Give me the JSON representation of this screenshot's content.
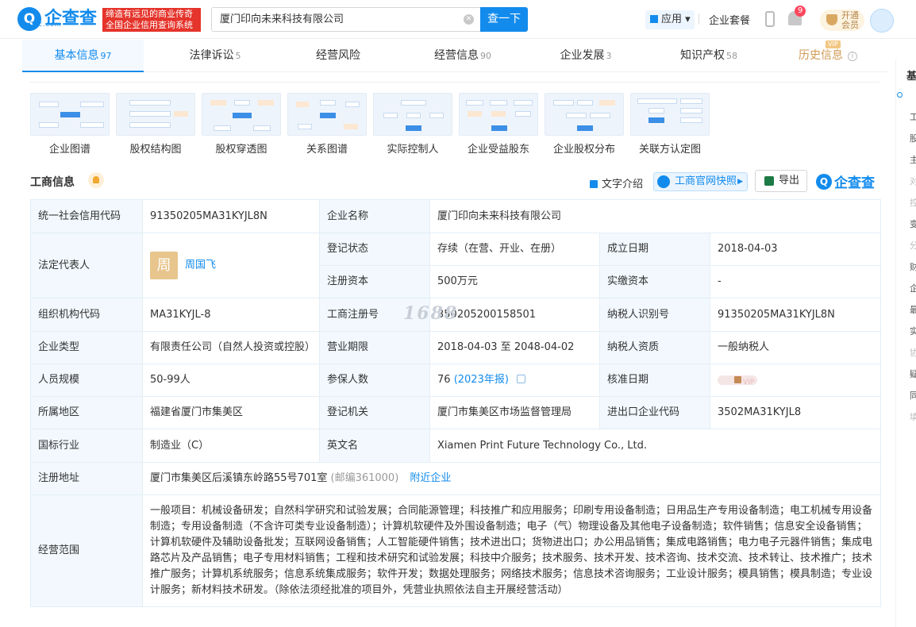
{
  "header": {
    "logo_mark": "Q",
    "logo_text": "企查查",
    "logo_sub": "Qcc.com",
    "slogan_line1": "缔造有远见的商业传奇",
    "slogan_line2": "全国企业信用查询系统",
    "search_value": "厦门印向未来科技有限公司",
    "search_button": "查一下",
    "app_label": "应用",
    "suite_label": "企业套餐",
    "notification_count": "9",
    "vip_line1": "开通",
    "vip_line2": "会员"
  },
  "tabs": [
    {
      "label": "基本信息",
      "count": "97"
    },
    {
      "label": "法律诉讼",
      "count": "5"
    },
    {
      "label": "经营风险",
      "count": ""
    },
    {
      "label": "经营信息",
      "count": "90"
    },
    {
      "label": "企业发展",
      "count": "3"
    },
    {
      "label": "知识产权",
      "count": "58"
    },
    {
      "label": "历史信息",
      "count": "",
      "badge": "VIP"
    }
  ],
  "graphs": [
    "企业图谱",
    "股权结构图",
    "股权穿透图",
    "关系图谱",
    "实际控制人",
    "企业受益股东",
    "企业股权分布",
    "关联方认定图"
  ],
  "section": {
    "title": "工商信息",
    "text_intro": "文字介绍",
    "snapshot": "工商官网快照",
    "export": "导出",
    "brand": "企查查"
  },
  "info": {
    "credit_code_label": "统一社会信用代码",
    "credit_code": "91350205MA31KYJL8N",
    "company_name_label": "企业名称",
    "company_name": "厦门印向未来科技有限公司",
    "legal_rep_label": "法定代表人",
    "legal_rep_avatar": "周",
    "legal_rep": "周国飞",
    "status_label": "登记状态",
    "status": "存续（在营、开业、在册）",
    "founded_label": "成立日期",
    "founded": "2018-04-03",
    "reg_capital_label": "注册资本",
    "reg_capital": "500万元",
    "paid_capital_label": "实缴资本",
    "paid_capital": "-",
    "org_code_label": "组织机构代码",
    "org_code": "MA31KYJL-8",
    "reg_no_label": "工商注册号",
    "reg_no": "350205200158501",
    "taxpayer_id_label": "纳税人识别号",
    "taxpayer_id": "91350205MA31KYJL8N",
    "company_type_label": "企业类型",
    "company_type": "有限责任公司（自然人投资或控股）",
    "term_label": "营业期限",
    "term": "2018-04-03 至 2048-04-02",
    "taxpayer_qual_label": "纳税人资质",
    "taxpayer_qual": "一般纳税人",
    "staff_label": "人员规模",
    "staff": "50-99人",
    "insured_label": "参保人数",
    "insured": "76",
    "insured_year": "(2023年报)",
    "approval_label": "核准日期",
    "approval_masked": "VIP",
    "region_label": "所属地区",
    "region": "福建省厦门市集美区",
    "authority_label": "登记机关",
    "authority": "厦门市集美区市场监督管理局",
    "ie_code_label": "进出口企业代码",
    "ie_code": "3502MA31KYJL8",
    "industry_label": "国标行业",
    "industry": "制造业（C）",
    "english_label": "英文名",
    "english": "Xiamen Print Future Technology Co., Ltd.",
    "address_label": "注册地址",
    "address": "厦门市集美区后溪镇东岭路55号701室",
    "postcode": "(邮编361000)",
    "nearby": "附近企业",
    "scope_label": "经营范围",
    "scope": "一般项目：机械设备研发；自然科学研究和试验发展；合同能源管理；科技推广和应用服务；印刷专用设备制造；日用品生产专用设备制造；电工机械专用设备制造；专用设备制造（不含许可类专业设备制造）；计算机软硬件及外围设备制造；电子（气）物理设备及其他电子设备制造；软件销售；信息安全设备销售；计算机软硬件及辅助设备批发；互联网设备销售；人工智能硬件销售；技术进出口；货物进出口；办公用品销售；集成电路销售；电力电子元器件销售；集成电路芯片及产品销售；电子专用材料销售；工程和技术研究和试验发展；科技中介服务；技术服务、技术开发、技术咨询、技术交流、技术转让、技术推广；技术推广服务；计算机系统服务；信息系统集成服务；软件开发；数据处理服务；网络技术服务；信息技术咨询服务；工业设计服务；模具销售；模具制造；专业设计服务；新材料技术研发。（除依法须经批准的项目外，凭营业执照依法自主开展经营活动）"
  },
  "watermark": "1688",
  "rail": {
    "title": "基",
    "items": [
      "工",
      "股",
      "主",
      "对",
      "控",
      "变",
      "分",
      "财",
      "企",
      "最",
      "实",
      "协",
      "疑",
      "同",
      "填"
    ]
  }
}
